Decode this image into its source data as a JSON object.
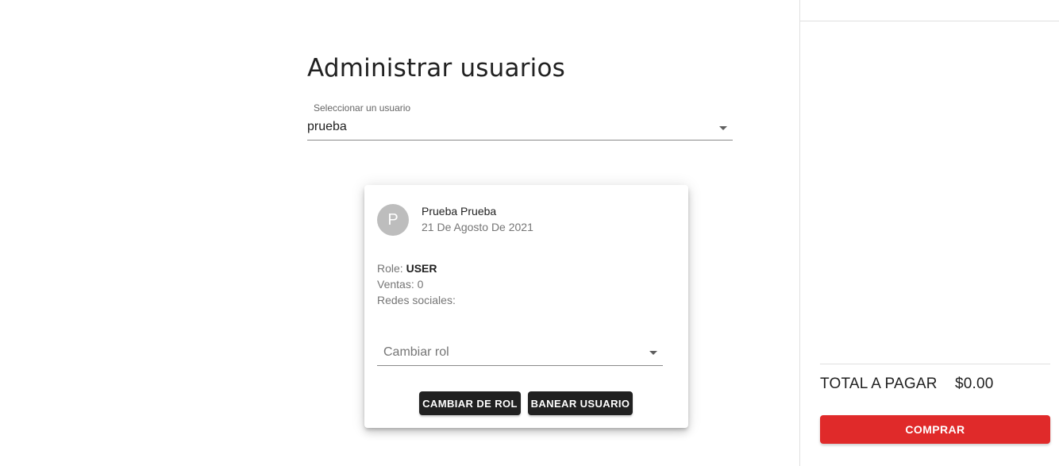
{
  "page": {
    "title": "Administrar usuarios"
  },
  "user_select": {
    "label": "Seleccionar un usuario",
    "value": "prueba"
  },
  "user_card": {
    "avatar_initial": "P",
    "name": "Prueba Prueba",
    "date": "21 De Agosto De 2021",
    "role_label": "Role: ",
    "role_value": "USER",
    "ventas_label": "Ventas: ",
    "ventas_value": "0",
    "redes_label": "Redes sociales:",
    "role_select_placeholder": "Cambiar rol",
    "change_role_button": "CAMBIAR DE ROL",
    "ban_user_button": "BANEAR USUARIO"
  },
  "cart": {
    "total_label": "TOTAL A PAGAR",
    "total_value": "$0.00",
    "buy_button": "COMPRAR"
  },
  "colors": {
    "buy_button": "#e02a2a",
    "action_button": "#212121",
    "avatar": "#bdbdbd"
  }
}
